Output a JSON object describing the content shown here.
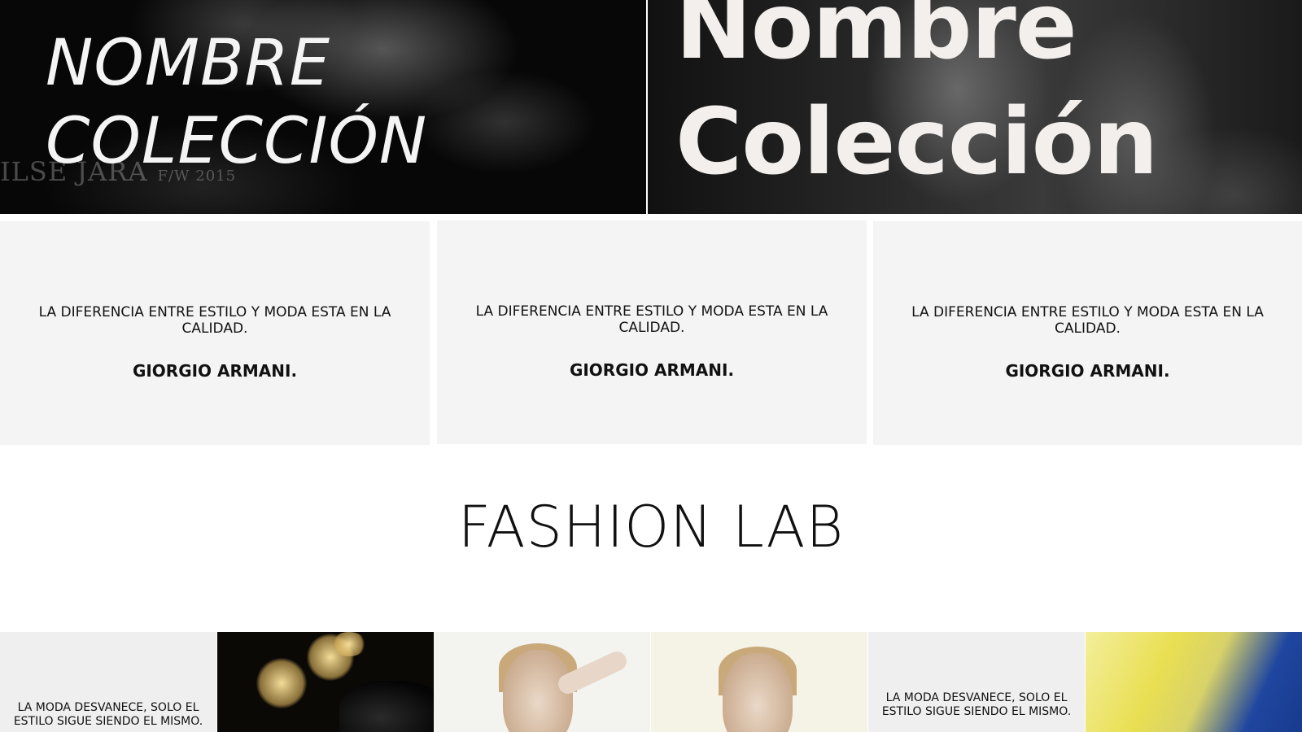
{
  "hero": {
    "left_title_line1": "NOMBRE",
    "left_title_line2": "COLECCIÓN",
    "left_watermark_brand": "ILSE JARA",
    "left_watermark_season": "F/W 2015",
    "right_title_line1": "Nombre",
    "right_title_line2": "Colección"
  },
  "quotes": [
    {
      "text": "LA DIFERENCIA ENTRE ESTILO Y MODA ESTA EN LA CALIDAD.",
      "author": "GIORGIO ARMANI."
    },
    {
      "text": "LA DIFERENCIA ENTRE ESTILO Y MODA ESTA EN LA CALIDAD.",
      "author": "GIORGIO ARMANI."
    },
    {
      "text": "LA DIFERENCIA ENTRE ESTILO Y MODA ESTA EN LA CALIDAD.",
      "author": "GIORGIO ARMANI."
    }
  ],
  "section_title": "FASHION LAB",
  "gallery": {
    "tile1_text": "LA MODA DESVANECE, SOLO EL ESTILO SIGUE SIENDO EL MISMO.",
    "tile5_text": "LA MODA DESVANECE, SOLO EL ESTILO SIGUE SIENDO EL MISMO."
  },
  "colors": {
    "card_background": "#f4f4f4",
    "hero_text": "#f2efec",
    "title_text": "#111111"
  }
}
